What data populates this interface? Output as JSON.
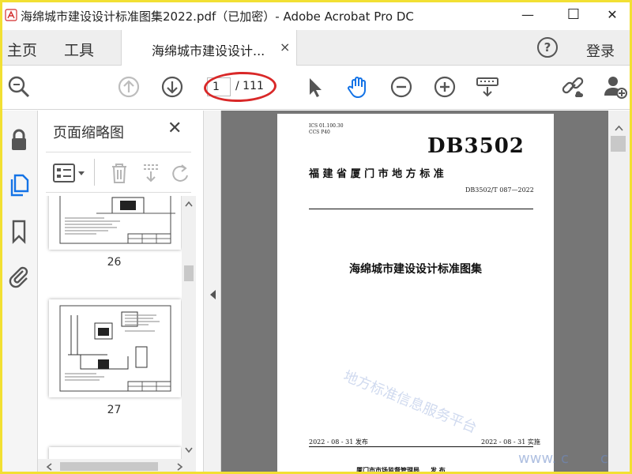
{
  "window": {
    "title": "海绵城市建设设计标准图集2022.pdf（已加密）- Adobe Acrobat Pro DC",
    "minimize": "—",
    "maximize": "☐",
    "close": "✕"
  },
  "menu": {
    "home": "主页",
    "tools": "工具",
    "tab_label": "海绵城市建设设计...",
    "tab_close": "×",
    "help": "?",
    "login": "登录"
  },
  "toolbar": {
    "current_page": "1",
    "total_pages": "/ 111"
  },
  "thumbnails": {
    "title": "页面缩略图",
    "close": "✕",
    "items": [
      {
        "page": "26"
      },
      {
        "page": "27"
      }
    ]
  },
  "document": {
    "ics": "ICS  01.100.30",
    "ccs": "CCS  P40",
    "code": "DB3502",
    "standard_type": "福 建 省 厦 门 市 地 方 标 准",
    "number": "DB3502/T 087—2022",
    "title": "海绵城市建设设计标准图集",
    "publish_date": "2022 - 08 - 31 发布",
    "effective_date": "2022 - 08 - 31 实施",
    "publisher": "厦门市市场监督管理局     发 布",
    "watermark": "地方标准信息服务平台",
    "watermark_url": "www. c       com"
  },
  "colors": {
    "accent_blue": "#1473e6",
    "annotation_red": "#d92828",
    "frame_yellow": "#f2e033",
    "doc_bg": "#767676"
  }
}
